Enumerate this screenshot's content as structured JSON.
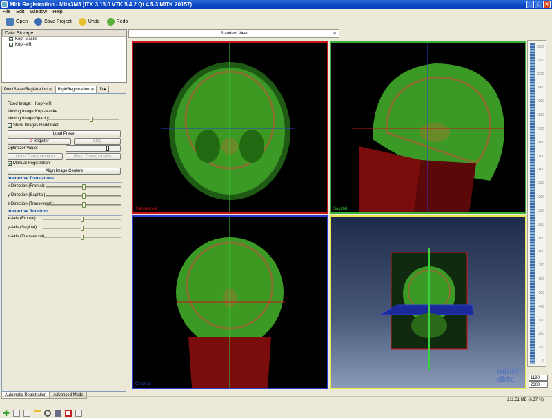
{
  "window": {
    "title": "Mitk Registration - Mitk3M3 (ITK 3.16.0  VTK 5.4.2 Qt 4.5.3 MITK 20157)",
    "buttons": [
      "_",
      "□",
      "✕"
    ]
  },
  "menu": [
    "File",
    "Edit",
    "Window",
    "Help"
  ],
  "toolbar": {
    "open": "Open",
    "save_project": "Save Project",
    "undo": "Undo",
    "redo": "Redo"
  },
  "data_storage": {
    "title": "Data Storage",
    "items": [
      "Kopf-Maske",
      "Kopf-MR"
    ]
  },
  "plugin_tabs": [
    "PointBasedRegistration",
    "RigidRegistration",
    "D"
  ],
  "registration": {
    "fixed_label": "Fixed Image:",
    "fixed_value": "Kopf-MR",
    "moving_label": "Moving Image :",
    "moving_value": "Kopf-Maske",
    "opacity_label": "Moving Image Opacity:",
    "opacity_value": 0.62,
    "show_red_green": "Show Images Red/Green",
    "load_preset": "Load Preset",
    "register": "Register",
    "stop": "Stop",
    "optimizer_label": "Optimizer Value:",
    "undo_transform": "Undo Transformation",
    "redo_transform": "Redo Transformation",
    "manual_registration": "Manual Registration",
    "align_centers": "Align Image Centers",
    "translations_title": "Interactive Translations",
    "translations": [
      {
        "label": "x-Direction (Frontal):",
        "value": 0.5
      },
      {
        "label": "y-Direction (Sagittal):",
        "value": 0.5
      },
      {
        "label": "z-Direction (Transversal):",
        "value": 0.5
      }
    ],
    "rotations_title": "Interactive Rotations",
    "rotations": [
      {
        "label": "x-Axis (Frontal):",
        "value": 0.5
      },
      {
        "label": "y-Axis (Sagittal):",
        "value": 0.5
      },
      {
        "label": "z-Axis (Transversal):",
        "value": 0.5
      }
    ]
  },
  "bottom_tabs": [
    "Automatic Registration",
    "Advanced Mode"
  ],
  "editor": {
    "tab": "Standard View",
    "views": {
      "transversal": "Transversal",
      "sagittal": "Sagittal",
      "coronal": "Coronal"
    },
    "logo": [
      "mbi@",
      "dkfz."
    ]
  },
  "level_window": {
    "level": "1190",
    "window": "2300",
    "ticks": [
      "2300",
      "2200",
      "2100",
      "2000",
      "1900",
      "1800",
      "1700",
      "1600",
      "1500",
      "1400",
      "1300",
      "1200",
      "1100",
      "1000",
      "900",
      "800",
      "700",
      "600",
      "500",
      "400",
      "300",
      "200",
      "100",
      "0"
    ]
  },
  "status": {
    "memory": "211.51 MB (6.37 %)"
  },
  "colors": {
    "transversal_border": "#c8161a",
    "sagittal_border": "#3ab03a",
    "coronal_border": "#2a3ed0",
    "view3d_border": "#e8e84a",
    "accent": "#0b4ea8"
  }
}
